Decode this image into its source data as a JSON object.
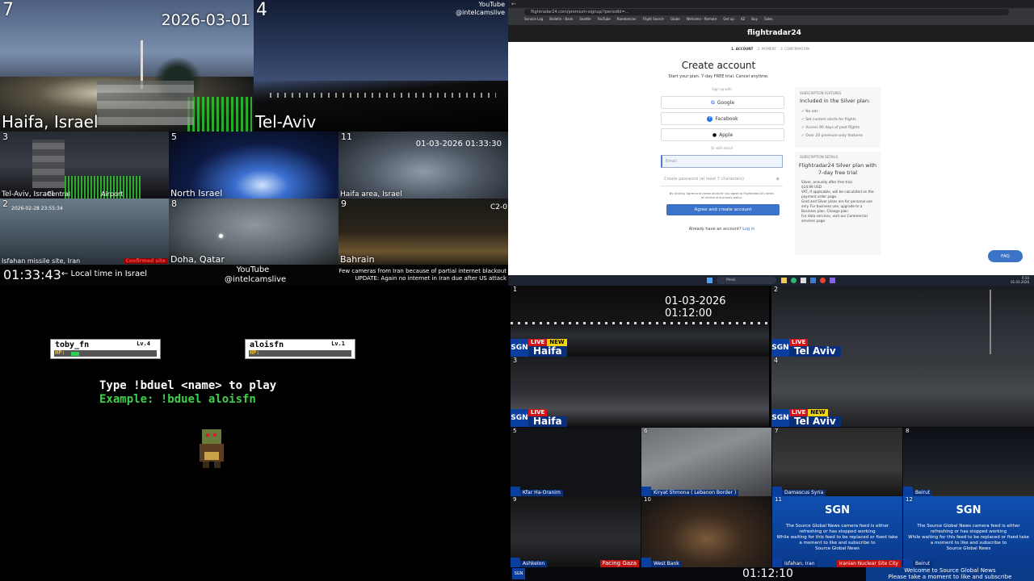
{
  "top_left": {
    "date": "2026-03-01",
    "youtube": "YouTube",
    "channel": "@intelcamslive",
    "cams": [
      {
        "num": "7",
        "label": "Haifa, Israel"
      },
      {
        "num": "4",
        "label": "Tel-Aviv"
      },
      {
        "num": "3",
        "label": "Tel-Aviv, Israel",
        "sub1": "Central",
        "sub2": "Airport"
      },
      {
        "num": "5",
        "label": "North Israel"
      },
      {
        "num": "11",
        "label": "Haifa area, Israel",
        "timestamp": "01-03-2026 01:33:30"
      },
      {
        "num": "2",
        "label": "Isfahan missile site, Iran",
        "timestamp": "2026-02-28  23:55:34",
        "badge": "Confirmed site"
      },
      {
        "num": "8",
        "label": "Doha, Qatar"
      },
      {
        "num": "9",
        "label": "Bahrain",
        "corner": "C2-0"
      }
    ],
    "footer": {
      "clock": "01:33:43",
      "local_label": "← Local time in Israel",
      "youtube": "YouTube",
      "channel": "@intelcamslive",
      "notice1": "Few cameras from Iran because of partial internet blackout",
      "notice2": "UPDATE: Again no internet in Iran due after US attack"
    }
  },
  "browser": {
    "url": "flightradar24.com/premium-signup/?periodId=...",
    "bookmarks": [
      "Service Log",
      "Bulletin - Bank",
      "Seattle",
      "YouTube",
      "Randomizer",
      "Flight Search",
      "Globe",
      "Welcome - Remote",
      "Get up",
      "AZ",
      "Buy",
      "Sales"
    ],
    "brand": "flightradar24",
    "steps": [
      "1. ACCOUNT",
      "2. PAYMENT",
      "3. CONFIRMATION"
    ],
    "heading": "Create account",
    "subheading": "Start your plan. 7-day FREE trial. Cancel anytime.",
    "signup_with": "Sign up with",
    "google": "Google",
    "facebook": "Facebook",
    "apple": "Apple",
    "or_email": "Or with email",
    "email_placeholder": "Email",
    "password_placeholder": "Create password (at least 7 characters)",
    "terms": "By clicking 'Agree and create account' you agree to Flightradar24's terms of service and privacy policy.",
    "submit": "Agree and create account",
    "already": "Already have an account?",
    "login": "Log in",
    "features_title": "SUBSCRIPTION FEATURES",
    "features_heading": "Included in the Silver plan:",
    "features": [
      "No ads",
      "Set custom alerts for flights",
      "Access 90 days of past flights",
      "Over 20 premium-only features"
    ],
    "details_title": "SUBSCRIPTION DETAILS",
    "details_heading": "Flightradar24 Silver plan with 7-day free trial",
    "details": [
      "Silver, annually after free trial",
      "$14.99 USD",
      "VAT, if applicable, will be calculated on the payment order page.",
      "Gold and Silver plans are for personal use only. For business use, upgrade to a Business plan. Change plan",
      "For data services, visit our Commercial services page."
    ],
    "faq": "FAQ",
    "taskbar_search": "Mesk",
    "taskbar_time": "0:34",
    "taskbar_date": "01.03.2026"
  },
  "game": {
    "player1": {
      "name": "toby_fn",
      "level": "Lv.4",
      "hp": "HP:",
      "hp_fraction": 0.1
    },
    "player2": {
      "name": "aloisfn",
      "level": "Lv.1",
      "hp": "HP:",
      "hp_fraction": 0.0
    },
    "instruction": "Type !bduel <name> to play",
    "example": "Example: !bduel aloisfn"
  },
  "sgn": {
    "timestamp": "01-03-2026 01:12:00",
    "clock": "01:12:10",
    "big": [
      {
        "num": "1",
        "live": "LIVE",
        "new": "NEW",
        "city": "Haifa"
      },
      {
        "num": "2",
        "live": "LIVE",
        "new": "",
        "city": "Tel Aviv"
      },
      {
        "num": "3",
        "live": "LIVE",
        "new": "",
        "city": "Haifa"
      },
      {
        "num": "4",
        "live": "LIVE",
        "new": "NEW",
        "city": "Tel Aviv"
      }
    ],
    "small": [
      {
        "num": "5",
        "city": "Kfar Ha-Oranim"
      },
      {
        "num": "6",
        "city": "Kiryat Shmona ( Lebanon Border )"
      },
      {
        "num": "7",
        "city": "Damascus Syria"
      },
      {
        "num": "8",
        "city": "Beirut"
      },
      {
        "num": "9",
        "city": "Ashkelon",
        "tag": "Facing Gaza"
      },
      {
        "num": "10",
        "city": "West Bank"
      },
      {
        "num": "11",
        "city": "Isfahan, Iran",
        "tag": "Iranian Nuclear Site City"
      },
      {
        "num": "12",
        "city": "Beirut"
      }
    ],
    "offline_logo": "SGN",
    "offline_text": "The Source Global News camera feed is either refreshing or has stopped working",
    "offline_text2": "While waiting for this feed to be replaced or fixed take a moment to like and subscribe to",
    "offline_text3": "Source Global News",
    "welcome": "Welcome to Source Global News",
    "welcome2": "Please take a moment to like and subscribe"
  }
}
